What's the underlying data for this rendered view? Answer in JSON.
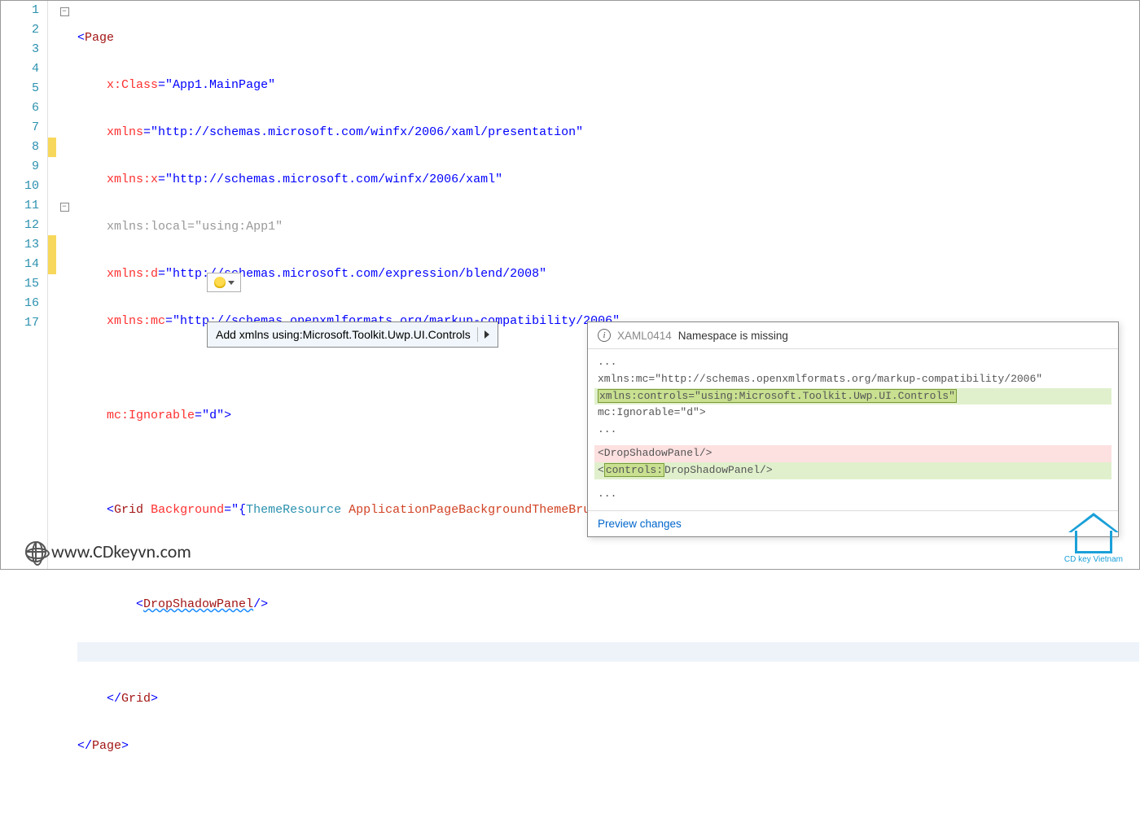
{
  "gutter": {
    "lines": [
      "1",
      "2",
      "3",
      "4",
      "5",
      "6",
      "7",
      "8",
      "9",
      "10",
      "11",
      "12",
      "13",
      "14",
      "15",
      "16",
      "17"
    ]
  },
  "folds": {
    "l1": "−",
    "l11": "−"
  },
  "code": {
    "l1": {
      "open": "<",
      "tag": "Page"
    },
    "l2": {
      "attr": "x:Class",
      "eq": "=",
      "val": "\"App1.MainPage\""
    },
    "l3": {
      "attr": "xmlns",
      "eq": "=",
      "val": "\"http://schemas.microsoft.com/winfx/2006/xaml/presentation\""
    },
    "l4": {
      "attr": "xmlns:x",
      "eq": "=",
      "val": "\"http://schemas.microsoft.com/winfx/2006/xaml\""
    },
    "l5": {
      "attr": "xmlns:local",
      "eq": "=",
      "val": "\"using:App1\""
    },
    "l6": {
      "attr": "xmlns:d",
      "eq": "=",
      "val": "\"http://schemas.microsoft.com/expression/blend/2008\""
    },
    "l7": {
      "attr": "xmlns:mc",
      "eq": "=",
      "val": "\"http://schemas.openxmlformats.org/markup-compatibility/2006\""
    },
    "l9": {
      "attr": "mc:Ignorable",
      "eq": "=",
      "val": "\"d\"",
      "close": ">"
    },
    "l11": {
      "open": "<",
      "tag": "Grid",
      "sp": " ",
      "attr": "Background",
      "eq": "=",
      "vopen": "\"{",
      "kw1": "ThemeResource",
      "sp2": " ",
      "kw2": "ApplicationPageBackgroundThemeBrush",
      "vclose": "}\"",
      "close": ">"
    },
    "l13": {
      "open": "<",
      "tag": "DropShadowPanel",
      "close": "/>"
    },
    "l15": {
      "open": "</",
      "tag": "Grid",
      "close": ">"
    },
    "l16": {
      "open": "</",
      "tag": "Page",
      "close": ">"
    }
  },
  "quickfix": {
    "label": "Add xmlns using:Microsoft.Toolkit.Uwp.UI.Controls"
  },
  "preview": {
    "errcode": "XAML0414",
    "errmsg": "Namespace is missing",
    "ellipsis": "...",
    "mc_line": "xmlns:mc=\"http://schemas.openxmlformats.org/markup-compatibility/2006\"",
    "add_attr": "xmlns:controls",
    "add_eq": "=",
    "add_val": "\"using:Microsoft.Toolkit.Uwp.UI.Controls\"",
    "ign_line": "mc:Ignorable=\"d\">",
    "old_tag": "    <DropShadowPanel/>",
    "new_open": "    <",
    "new_prefix": "controls:",
    "new_rest": "DropShadowPanel/>",
    "link": "Preview changes"
  },
  "watermark": {
    "url": "www.CDkeyvn.com",
    "brand": "CD key Vietnam"
  }
}
